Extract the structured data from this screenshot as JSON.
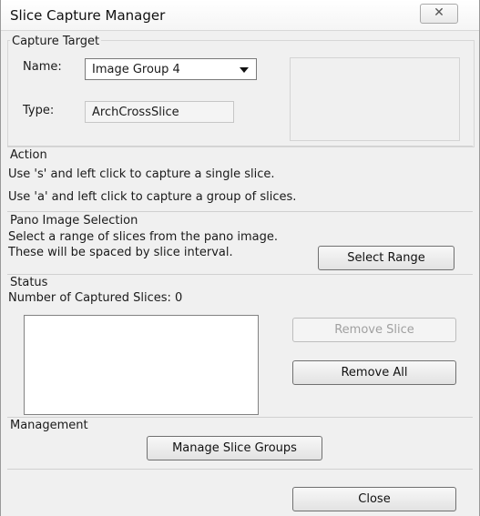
{
  "window": {
    "title": "Slice Capture Manager",
    "close_glyph": "✕"
  },
  "capture_target": {
    "title": "Capture Target",
    "name_label": "Name:",
    "name_value": "Image Group 4",
    "type_label": "Type:",
    "type_value": "ArchCrossSlice"
  },
  "action": {
    "title": "Action",
    "line1": "Use 's' and left click to capture a single slice.",
    "line2": "Use 'a' and left click to capture a group of slices."
  },
  "pano": {
    "title": "Pano Image Selection",
    "line1": "Select a range of slices from the pano image.",
    "line2": "These will be spaced by slice interval.",
    "select_range_label": "Select Range"
  },
  "status": {
    "title": "Status",
    "captured_text": "Number of Captured Slices: 0",
    "remove_slice_label": "Remove Slice",
    "remove_all_label": "Remove All"
  },
  "management": {
    "title": "Management",
    "manage_label": "Manage Slice Groups"
  },
  "footer": {
    "close_label": "Close"
  },
  "icons": {
    "close": "close-icon",
    "dropdown": "chevron-down-icon"
  }
}
